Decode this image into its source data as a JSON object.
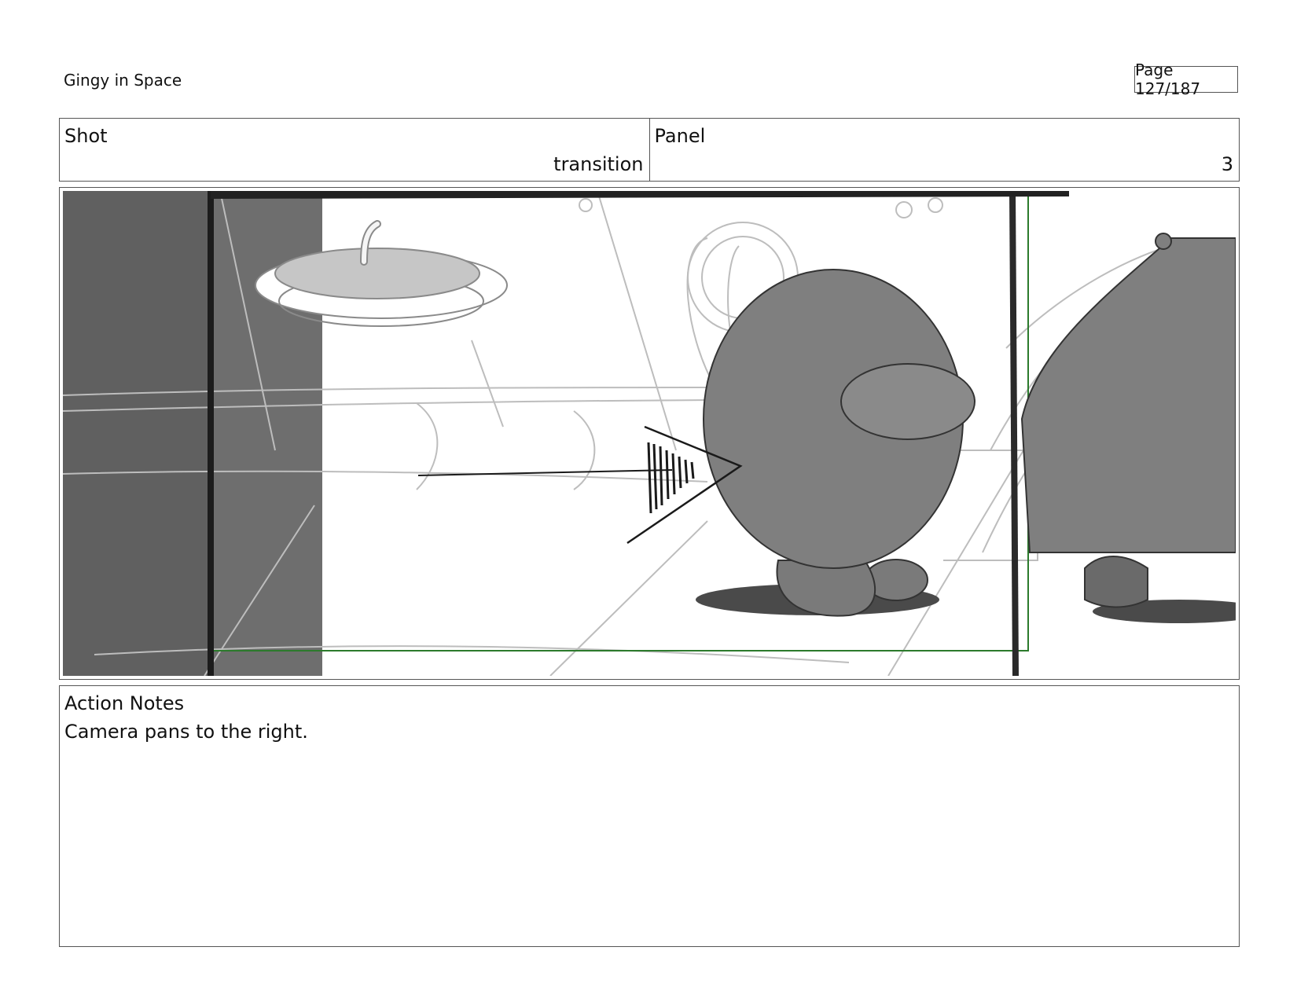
{
  "document": {
    "title": "Gingy in Space",
    "page_label": "Page 127/187"
  },
  "header": {
    "shot_label": "Shot",
    "shot_value": "transition",
    "panel_label": "Panel",
    "panel_value": "3"
  },
  "frame": {
    "description_icon": "storyboard-sketch-image"
  },
  "notes": {
    "label": "Action Notes",
    "text": "Camera pans to the right."
  }
}
